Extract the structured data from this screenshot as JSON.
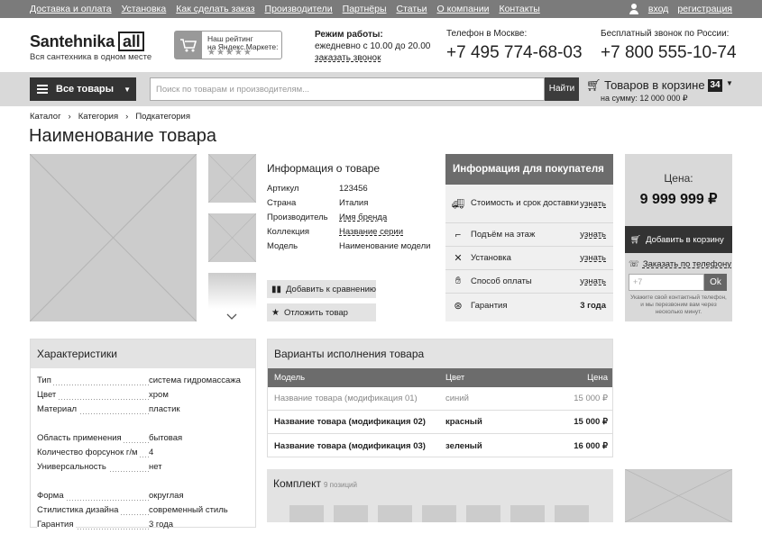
{
  "topnav": {
    "items": [
      "Доставка и оплата",
      "Установка",
      "Как сделать заказ",
      "Производители",
      "Партнёры",
      "Статьи",
      "О компании",
      "Контакты"
    ],
    "login": "вход",
    "register": "регистрация"
  },
  "header": {
    "logo_main": "Santehnika",
    "logo_box": "all",
    "logo_sub": "Вся сантехника в одном месте",
    "rating_text": "Наш рейтинг\nна Яндекс.Маркете:",
    "rating_stars": "★★★★★",
    "hours_title": "Режим работы:",
    "hours_value": "ежедневно с 10.00 до 20.00",
    "callback": "заказать звонок",
    "moscow_label": "Телефон в Москве:",
    "moscow_phone": "+7 495 774-68-03",
    "free_label": "Бесплатный звонок по России:",
    "free_phone": "+7 800 555-10-74"
  },
  "searchbar": {
    "catalog_button": "Все товары",
    "placeholder": "Поиск по товарам и производителям...",
    "go": "Найти",
    "cart_title": "Товаров в корзине",
    "cart_sum": "на сумму: 12 000 000 ₽",
    "cart_count": "34"
  },
  "breadcrumbs": [
    "Каталог",
    "›",
    "Категория",
    "›",
    "Подкатегория"
  ],
  "product": {
    "title": "Наименование товара",
    "info_title": "Информация о товаре",
    "info": [
      {
        "k": "Артикул",
        "v": "123456"
      },
      {
        "k": "Страна",
        "v": "Италия"
      },
      {
        "k": "Производитель",
        "v": "Имя бренда"
      },
      {
        "k": "Коллекция",
        "v": "Название серии"
      },
      {
        "k": "Модель",
        "v": "Наименование модели"
      }
    ],
    "compare": "Добавить к сравнению",
    "defer": "Отложить товар"
  },
  "buyer": {
    "title": "Информация для покупателя",
    "rows": [
      {
        "label": "Стоимость и срок доставки",
        "value": "узнать"
      },
      {
        "label": "Подъём на этаж",
        "value": "узнать"
      },
      {
        "label": "Установка",
        "value": "узнать"
      },
      {
        "label": "Способ оплаты",
        "value": "узнать"
      },
      {
        "label": "Гарантия",
        "value": "3 года"
      }
    ]
  },
  "price": {
    "label": "Цена:",
    "value": "9 999 999 ₽",
    "add": "Добавить в корзину",
    "phone_order": "Заказать по телефону",
    "phone_placeholder": "+7",
    "ok": "Ok",
    "note": "Укажите свой контактный телефон, и мы перезвоним вам через несколько минут."
  },
  "characteristics": {
    "title": "Характеристики",
    "rows": [
      {
        "k": "Тип",
        "v": "система гидромассажа"
      },
      {
        "k": "Цвет",
        "v": "хром"
      },
      {
        "k": "Материал",
        "v": "пластик"
      },
      null,
      {
        "k": "Область применения",
        "v": "бытовая"
      },
      {
        "k": "Количество форсунок г/м",
        "v": "4"
      },
      {
        "k": "Универсальность",
        "v": "нет"
      },
      null,
      {
        "k": "Форма",
        "v": "округлая"
      },
      {
        "k": "Стилистика дизайна",
        "v": "современный стиль"
      },
      {
        "k": "Гарантия",
        "v": "3 года"
      }
    ]
  },
  "variants": {
    "title": "Варианты исполнения товара",
    "columns": [
      "Модель",
      "Цвет",
      "Цена"
    ],
    "rows": [
      {
        "model": "Название товара (модификация 01)",
        "color": "синий",
        "price": "15 000 ₽"
      },
      {
        "model": "Название товара (модификация 02)",
        "color": "красный",
        "price": "15 000 ₽"
      },
      {
        "model": "Название товара (модификация 03)",
        "color": "зеленый",
        "price": "16 000 ₽"
      }
    ]
  },
  "kit": {
    "title": "Комплект",
    "count": "9 позиций"
  }
}
